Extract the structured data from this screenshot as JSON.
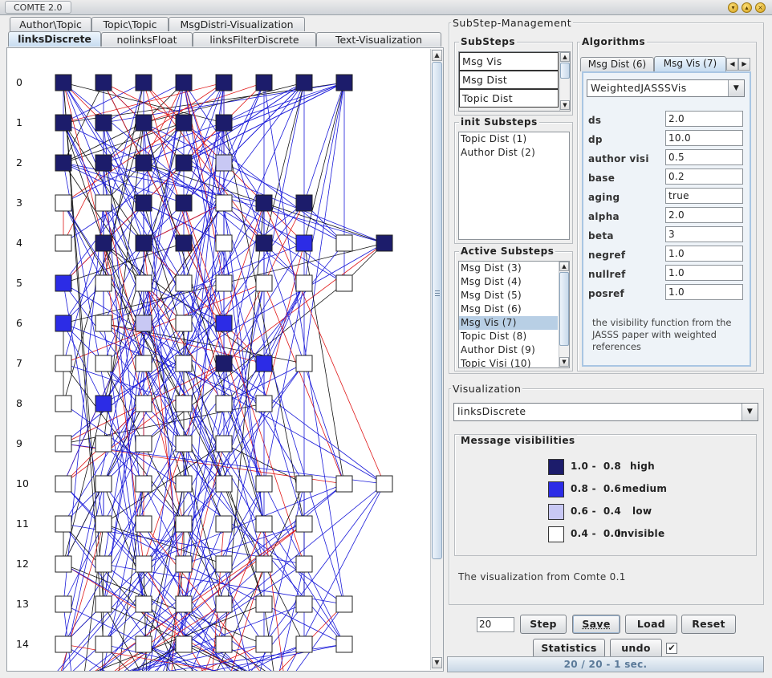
{
  "window": {
    "title": "COMTE 2.0"
  },
  "tabs_row1": [
    "Author\\Topic",
    "Topic\\Topic",
    "MsgDistri-Visualization"
  ],
  "tabs_row2": [
    "linksDiscrete",
    "nolinksFloat",
    "linksFilterDiscrete",
    "Text-Visualization"
  ],
  "graph": {
    "row_labels": [
      "0",
      "1",
      "2",
      "3",
      "4",
      "5",
      "6",
      "7",
      "8",
      "9",
      "10",
      "11",
      "12",
      "13",
      "14"
    ],
    "colors": {
      "high": "#1c1c6b",
      "medium": "#2c2ce6",
      "low": "#c8c8f4",
      "invisible": "#ffffff"
    }
  },
  "substep_mgmt": {
    "title": "SubStep-Management",
    "substeps_title": "SubSteps",
    "substeps": [
      "Msg Vis",
      "Msg Dist",
      "Topic Dist"
    ],
    "init_title": "init Substeps",
    "init_substeps": [
      "Topic Dist (1)",
      "Author Dist (2)"
    ],
    "active_title": "Active Substeps",
    "active_substeps": [
      "Msg Dist (3)",
      "Msg Dist (4)",
      "Msg Dist (5)",
      "Msg Dist (6)",
      "Msg Vis (7)",
      "Topic Dist (8)",
      "Author Dist (9)",
      "Topic Visi (10)"
    ],
    "active_selected": 4
  },
  "algorithms": {
    "title": "Algorithms",
    "tabs": [
      "Msg Dist (6)",
      "Msg Vis (7)"
    ],
    "selected_algorithm": "WeightedJASSSVis",
    "params": [
      {
        "label": "ds",
        "value": "2.0"
      },
      {
        "label": "dp",
        "value": "10.0"
      },
      {
        "label": "author visi",
        "value": "0.5"
      },
      {
        "label": "base",
        "value": "0.2"
      },
      {
        "label": "aging",
        "value": "true"
      },
      {
        "label": "alpha",
        "value": "2.0"
      },
      {
        "label": "beta",
        "value": "3"
      },
      {
        "label": "negref",
        "value": "1.0"
      },
      {
        "label": "nullref",
        "value": "1.0"
      },
      {
        "label": "posref",
        "value": "1.0"
      }
    ],
    "description": [
      "the visibility function from the",
      "JASSS paper with weighted",
      "references"
    ]
  },
  "visualization": {
    "title": "Visualization",
    "selected": "linksDiscrete",
    "legend_title": "Message visibilities",
    "legend": [
      {
        "range": "1.0 -  0.8",
        "label": "high",
        "color": "#1c1c6b"
      },
      {
        "range": "0.8 -  0.6",
        "label": "medium",
        "color": "#2c2ce6"
      },
      {
        "range": "0.6 -  0.4",
        "label": "low",
        "color": "#c8c8f4"
      },
      {
        "range": "0.4 -  0.0",
        "label": "invisible",
        "color": "#ffffff"
      }
    ],
    "note": "The visualization from Comte 0.1"
  },
  "controls": {
    "steps_value": "20",
    "step_label": "Step",
    "save_label": "Save",
    "load_label": "Load",
    "reset_label": "Reset",
    "statistics_label": "Statistics",
    "undo_label": "undo",
    "undo_checked": true,
    "status": "20 / 20 - 1 sec."
  }
}
